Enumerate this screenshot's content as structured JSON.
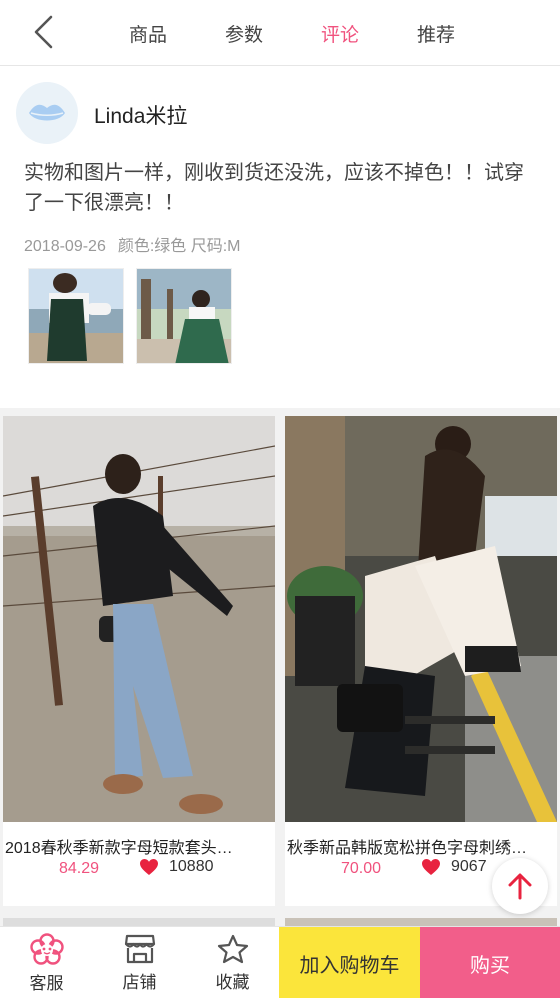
{
  "nav": {
    "tabs": [
      {
        "label": "商品"
      },
      {
        "label": "参数"
      },
      {
        "label": "评论"
      },
      {
        "label": "推荐"
      }
    ],
    "active_tab": "评论"
  },
  "review": {
    "username": "Linda米拉",
    "text": "实物和图片一样，刚收到货还没洗，应该不掉色！！试穿了一下很漂亮！！",
    "date": "2018-09-26",
    "specs": "颜色:绿色 尺码:M",
    "photos": [
      "review-photo-1",
      "review-photo-2"
    ]
  },
  "products": [
    {
      "title": "2018春秋季新款字母短款套头…",
      "price": "84.29",
      "likes": "10880"
    },
    {
      "title": "秋季新品韩版宽松拼色字母刺绣…",
      "price": "70.00",
      "likes": "9067"
    }
  ],
  "bottom_bar": {
    "service_label": "客服",
    "shop_label": "店铺",
    "favorite_label": "收藏",
    "cart_label": "加入购物车",
    "buy_label": "购买"
  },
  "colors": {
    "accent": "#f0527e",
    "cart_bg": "#fbe53b",
    "buy_bg": "#f25e8a"
  },
  "icons": [
    "chevron-left-icon",
    "lips-avatar-icon",
    "heart-icon",
    "flower-icon",
    "store-icon",
    "star-icon",
    "arrow-up-icon"
  ]
}
